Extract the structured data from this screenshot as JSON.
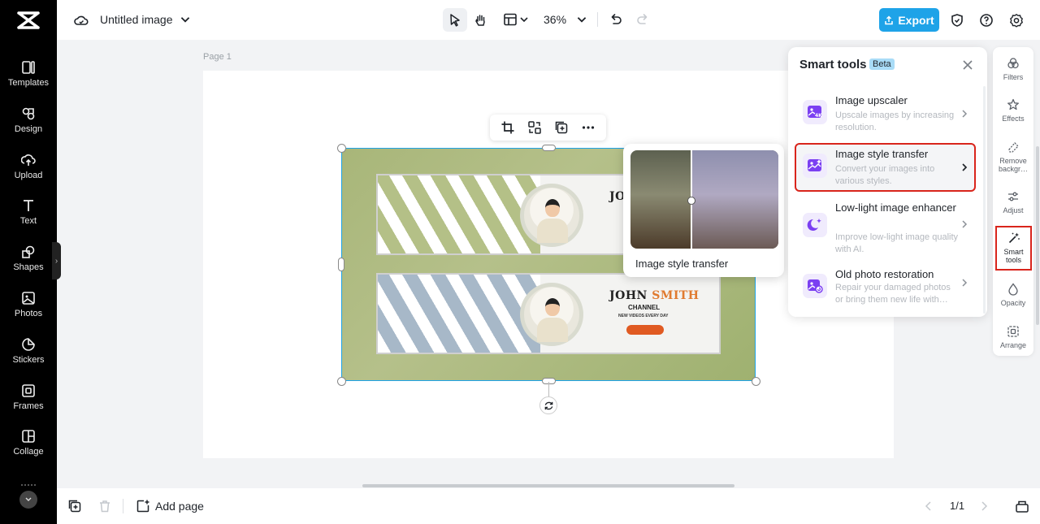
{
  "sidebar": {
    "items": [
      {
        "label": "Templates",
        "icon": "templates-icon"
      },
      {
        "label": "Design",
        "icon": "design-icon"
      },
      {
        "label": "Upload",
        "icon": "upload-icon"
      },
      {
        "label": "Text",
        "icon": "text-icon"
      },
      {
        "label": "Shapes",
        "icon": "shapes-icon"
      },
      {
        "label": "Photos",
        "icon": "photos-icon"
      },
      {
        "label": "Stickers",
        "icon": "stickers-icon"
      },
      {
        "label": "Frames",
        "icon": "frames-icon"
      },
      {
        "label": "Collage",
        "icon": "collage-icon"
      }
    ]
  },
  "header": {
    "title": "Untitled image",
    "zoom": "36%",
    "export_label": "Export"
  },
  "canvas": {
    "page_label": "Page 1",
    "banner": {
      "title_main": "JOHN ",
      "title_accent": "SMITH",
      "title_partial": "JO",
      "subtitle": "CHANNEL",
      "tagline": "NEW VIDEOS EVERY DAY"
    }
  },
  "preview": {
    "label": "Image style transfer"
  },
  "smart_tools": {
    "title": "Smart tools",
    "badge": "Beta",
    "items": [
      {
        "name": "Image upscaler",
        "desc": "Upscale images by increasing resolution."
      },
      {
        "name": "Image style transfer",
        "desc": "Convert your images into various styles."
      },
      {
        "name": "Low-light image enhancer",
        "desc": "Improve low-light image quality with AI."
      },
      {
        "name": "Old photo restoration",
        "desc": "Repair your damaged photos or bring them new life with…"
      }
    ]
  },
  "rail": {
    "items": [
      {
        "label": "Filters"
      },
      {
        "label": "Effects"
      },
      {
        "label": "Remove backgr…"
      },
      {
        "label": "Adjust"
      },
      {
        "label": "Smart tools"
      },
      {
        "label": "Opacity"
      },
      {
        "label": "Arrange"
      }
    ]
  },
  "footer": {
    "add_page": "Add page",
    "page_count": "1/1"
  },
  "colors": {
    "accent": "#1ea3e8",
    "highlight": "#d9251c",
    "sidebar_bg": "#000000"
  }
}
